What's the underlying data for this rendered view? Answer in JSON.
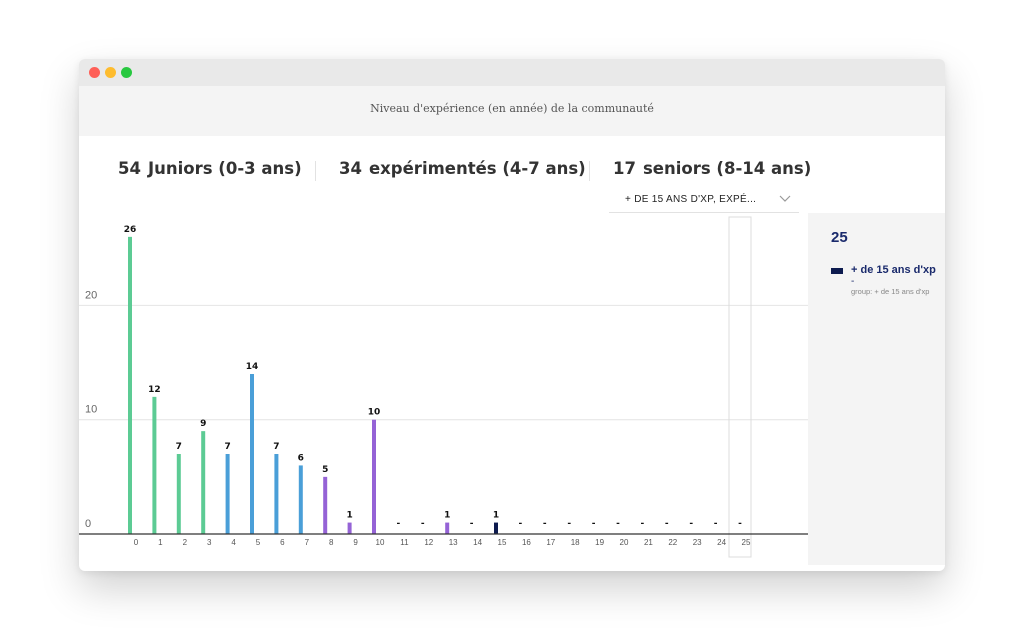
{
  "header": {
    "title": "Niveau d'expérience (en année) de la communauté"
  },
  "stats": [
    {
      "count": "54",
      "label": "Juniors (0-3 ans)"
    },
    {
      "count": "34",
      "label": "expérimentés (4-7 ans)"
    },
    {
      "count": "17",
      "label": "seniors (8-14 ans)"
    }
  ],
  "dropdown": {
    "selected": "+ DE 15 ANS D'XP, EXPÉ..."
  },
  "side_panel": {
    "value": "25",
    "series_name": "+ de 15 ans d'xp",
    "series_value": "-",
    "group_label": "group: + de 15 ans d'xp"
  },
  "colors": {
    "juniors": "#5ccb94",
    "experimentes": "#4a9fd8",
    "seniors": "#9563d6",
    "plus15": "#0d1b4f"
  },
  "chart_data": {
    "type": "bar",
    "categories": [
      "0",
      "1",
      "2",
      "3",
      "4",
      "5",
      "6",
      "7",
      "8",
      "9",
      "10",
      "11",
      "12",
      "13",
      "14",
      "15",
      "16",
      "17",
      "18",
      "19",
      "20",
      "21",
      "22",
      "23",
      "24",
      "25"
    ],
    "values": [
      26,
      12,
      7,
      9,
      7,
      14,
      7,
      6,
      5,
      1,
      10,
      null,
      null,
      1,
      null,
      1,
      null,
      null,
      null,
      null,
      null,
      null,
      null,
      null,
      null,
      null
    ],
    "data_labels": [
      "26",
      "12",
      "7",
      "9",
      "7",
      "14",
      "7",
      "6",
      "5",
      "1",
      "10",
      "-",
      "-",
      "1",
      "-",
      "1",
      "-",
      "-",
      "-",
      "-",
      "-",
      "-",
      "-",
      "-",
      "-",
      "-"
    ],
    "bar_groups": [
      "juniors",
      "juniors",
      "juniors",
      "juniors",
      "experimentes",
      "experimentes",
      "experimentes",
      "experimentes",
      "seniors",
      "seniors",
      "seniors",
      "seniors",
      "seniors",
      "seniors",
      "seniors",
      "plus15",
      "plus15",
      "plus15",
      "plus15",
      "plus15",
      "plus15",
      "plus15",
      "plus15",
      "plus15",
      "plus15",
      "plus15"
    ],
    "y_ticks": [
      0,
      10,
      20
    ],
    "ylim": [
      0,
      28
    ],
    "grid": true,
    "highlighted_category": "25"
  }
}
